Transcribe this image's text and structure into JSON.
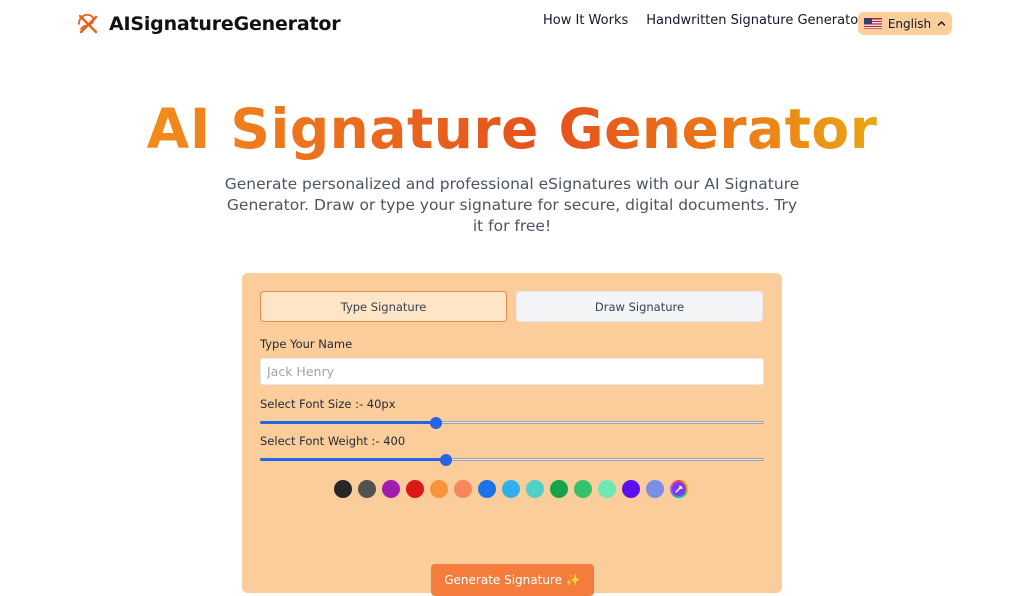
{
  "header": {
    "brand_name": "AISignatureGenerator",
    "nav": [
      {
        "label": "How It Works"
      },
      {
        "label": "Handwritten Signature Generator"
      }
    ],
    "language": {
      "label": "English",
      "icon": "us-flag-icon"
    }
  },
  "hero": {
    "title": "AI Signature Generator",
    "subtitle": "Generate personalized and professional eSignatures with our AI Signature Generator. Draw or type your signature for secure, digital documents. Try it for free!"
  },
  "card": {
    "tabs": [
      {
        "label": "Type Signature",
        "active": true
      },
      {
        "label": "Draw Signature",
        "active": false
      }
    ],
    "name_label": "Type Your Name",
    "name_value": "",
    "name_placeholder": "Jack Henry",
    "font_size_label": "Select Font Size :- 40px",
    "font_size_level": 0.35,
    "font_weight_label": "Select Font Weight :- 400",
    "font_weight_level": 0.37,
    "colors": [
      "#262626",
      "#525252",
      "#a21caf",
      "#dc1818",
      "#fb923c",
      "#f6875e",
      "#1a73e8",
      "#2fb0ec",
      "#4fd1c5",
      "#16a34a",
      "#34c26a",
      "#6ee7b7",
      "#5b10f0",
      "#7b8ee8"
    ],
    "color_picker_icon": "eyedropper-icon",
    "generate_label": "Generate Signature ✨"
  },
  "theme": {
    "accent": "#f47d3e",
    "card_bg": "#fbcd9a",
    "slider": "#2563eb"
  }
}
